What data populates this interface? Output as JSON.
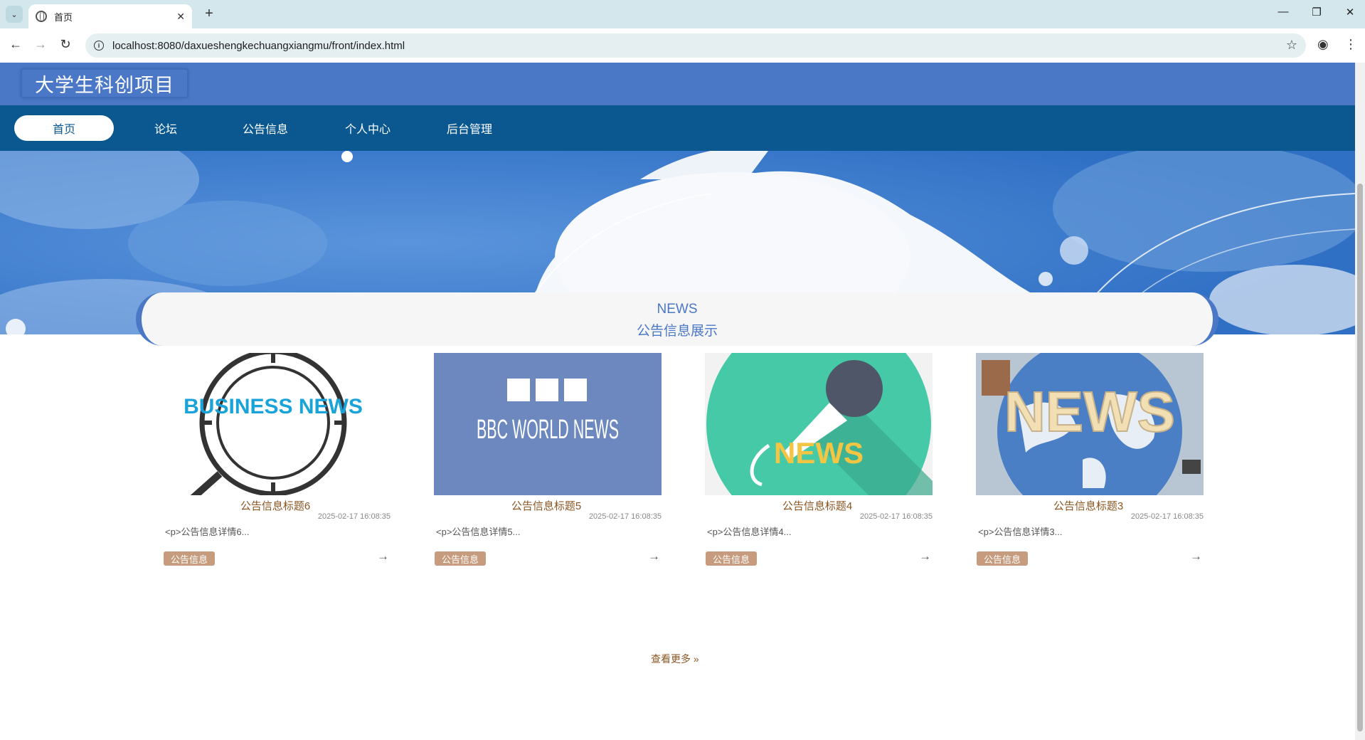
{
  "browser": {
    "tab_title": "首页",
    "url": "localhost:8080/daxueshengkechuangxiangmu/front/index.html"
  },
  "site": {
    "title": "大学生科创项目"
  },
  "nav": {
    "items": [
      {
        "label": "首页",
        "active": true
      },
      {
        "label": "论坛",
        "active": false
      },
      {
        "label": "公告信息",
        "active": false
      },
      {
        "label": "个人中心",
        "active": false
      },
      {
        "label": "后台管理",
        "active": false
      }
    ]
  },
  "banner": {
    "slide_count": 3,
    "active_slide": 2
  },
  "news_section": {
    "heading_en": "NEWS",
    "heading_cn": "公告信息展示",
    "items": [
      {
        "image_text": "BUSINESS NEWS",
        "title": "公告信息标题6",
        "date": "2025-02-17 16:08:35",
        "desc": "<p>公告信息详情6...",
        "tag": "公告信息",
        "arrow": "→"
      },
      {
        "image_text": "BBC WORLD NEWS",
        "title": "公告信息标题5",
        "date": "2025-02-17 16:08:35",
        "desc": "<p>公告信息详情5...",
        "tag": "公告信息",
        "arrow": "→"
      },
      {
        "image_text": "NEWS",
        "title": "公告信息标题4",
        "date": "2025-02-17 16:08:35",
        "desc": "<p>公告信息详情4...",
        "tag": "公告信息",
        "arrow": "→"
      },
      {
        "image_text": "NEWS",
        "title": "公告信息标题3",
        "date": "2025-02-17 16:08:35",
        "desc": "<p>公告信息详情3...",
        "tag": "公告信息",
        "arrow": "→"
      }
    ],
    "more_label": "查看更多 »"
  },
  "colors": {
    "header_blue": "#4a78c6",
    "nav_blue": "#0b5891",
    "title_brown": "#8c5622",
    "tag_bg": "#c79c7e"
  }
}
